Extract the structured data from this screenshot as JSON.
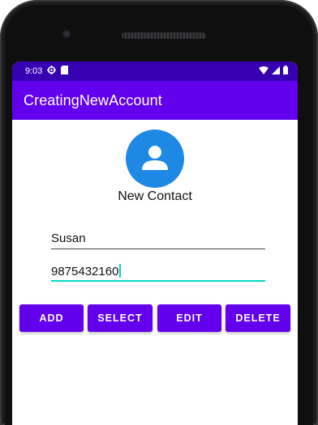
{
  "status_bar": {
    "time": "9:03",
    "icons": [
      "settings-gear-icon",
      "sd-card-icon",
      "wifi-icon",
      "signal-icon",
      "battery-icon"
    ],
    "background": "#3700b3"
  },
  "app_bar": {
    "title": "CreatingNewAccount",
    "background": "#6200ee"
  },
  "contact": {
    "avatar_icon": "person-icon",
    "avatar_color": "#1e88e5",
    "title": "New Contact"
  },
  "form": {
    "name_value": "Susan",
    "phone_value": "9875432160",
    "accent": "#03dac5"
  },
  "buttons": {
    "add": "ADD",
    "select": "SELECT",
    "edit": "EDIT",
    "delete": "DELETE",
    "color": "#6200ee"
  }
}
